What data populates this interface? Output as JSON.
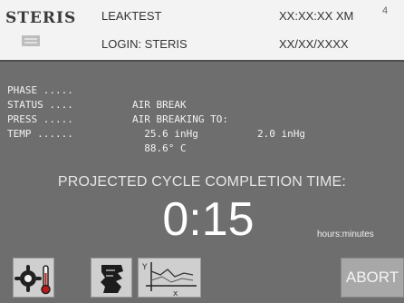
{
  "header": {
    "brand": "STERIS",
    "cycle_name": "LEAKTEST",
    "login": "LOGIN: STERIS",
    "time": "XX:XX:XX XM",
    "date": "XX/XX/XXXX",
    "corner_number": "4"
  },
  "status": {
    "rows": [
      {
        "label": "PHASE .....",
        "value": "AIR BREAK",
        "value2": ""
      },
      {
        "label": "STATUS ....",
        "value": "AIR BREAKING TO:",
        "value2": "2.0 inHg"
      },
      {
        "label": "PRESS .....",
        "value": "  25.6 inHg",
        "value2": ""
      },
      {
        "label": "TEMP ......",
        "value": "  88.6° C",
        "value2": ""
      }
    ]
  },
  "projection": {
    "label": "PROJECTED CYCLE COMPLETION TIME:",
    "time": "0:15",
    "units": "hours:minutes"
  },
  "buttons": {
    "settings_icon": "gear-thermometer-icon",
    "report_icon": "printer-report-icon",
    "graph_icon": "graph-icon",
    "graph_x_label": "x",
    "graph_y_label": "Y",
    "abort_label": "ABORT"
  },
  "colors": {
    "background": "#6e6e6e",
    "header": "#f3f3f3",
    "button": "#cfcfcf",
    "abort_button": "#a8a8a8"
  }
}
